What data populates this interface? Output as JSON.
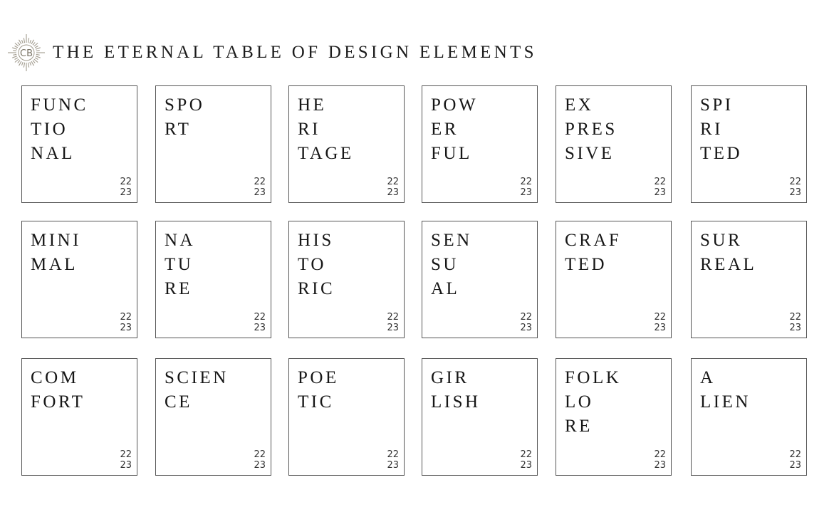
{
  "header": {
    "logo_text": "CB",
    "logo_icon": "sunburst-monogram-logo",
    "title": "THE ETERNAL TABLE OF DESIGN ELEMENTS"
  },
  "colors": {
    "logo": "#a09a8c",
    "text": "#161616",
    "border": "#555555"
  },
  "tiles": [
    {
      "lines": [
        "FUNC",
        "TIO",
        "NAL"
      ],
      "year": [
        "22",
        "23"
      ]
    },
    {
      "lines": [
        "SPO",
        "RT"
      ],
      "year": [
        "22",
        "23"
      ]
    },
    {
      "lines": [
        "HE",
        "RI",
        "TAGE"
      ],
      "year": [
        "22",
        "23"
      ]
    },
    {
      "lines": [
        "POW",
        "ER",
        "FUL"
      ],
      "year": [
        "22",
        "23"
      ]
    },
    {
      "lines": [
        "EX",
        "PRES",
        "SIVE"
      ],
      "year": [
        "22",
        "23"
      ]
    },
    {
      "lines": [
        "SPI",
        "RI",
        "TED"
      ],
      "year": [
        "22",
        "23"
      ]
    },
    {
      "lines": [
        "MINI",
        "MAL"
      ],
      "year": [
        "22",
        "23"
      ]
    },
    {
      "lines": [
        "NA",
        "TU",
        "RE"
      ],
      "year": [
        "22",
        "23"
      ]
    },
    {
      "lines": [
        "HIS",
        "TO",
        "RIC"
      ],
      "year": [
        "22",
        "23"
      ]
    },
    {
      "lines": [
        "SEN",
        "SU",
        "AL"
      ],
      "year": [
        "22",
        "23"
      ]
    },
    {
      "lines": [
        "CRAF",
        "TED"
      ],
      "year": [
        "22",
        "23"
      ]
    },
    {
      "lines": [
        "SUR",
        "REAL"
      ],
      "year": [
        "22",
        "23"
      ]
    },
    {
      "lines": [
        "COM",
        "FORT"
      ],
      "year": [
        "22",
        "23"
      ]
    },
    {
      "lines": [
        "SCIEN",
        "CE"
      ],
      "year": [
        "22",
        "23"
      ]
    },
    {
      "lines": [
        "POE",
        "TIC"
      ],
      "year": [
        "22",
        "23"
      ]
    },
    {
      "lines": [
        "GIR",
        "LISH"
      ],
      "year": [
        "22",
        "23"
      ]
    },
    {
      "lines": [
        "FOLK",
        "LO",
        "RE"
      ],
      "year": [
        "22",
        "23"
      ]
    },
    {
      "lines": [
        "A",
        "LIEN"
      ],
      "year": [
        "22",
        "23"
      ]
    }
  ]
}
